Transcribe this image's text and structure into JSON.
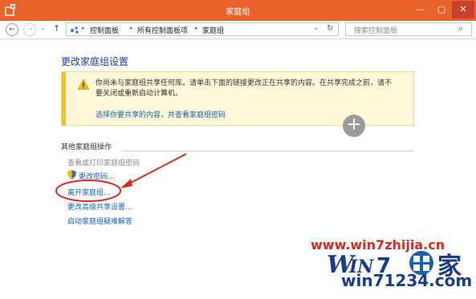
{
  "window": {
    "title": "家庭组",
    "minimize": "—",
    "maximize": "▢",
    "close": "✕"
  },
  "address": {
    "back": "←",
    "forward": "→",
    "up": "↑",
    "crumbs": [
      "控制面板",
      "所有控制面板项",
      "家庭组"
    ],
    "refresh": "↻",
    "dropdown": "⌄",
    "search_placeholder": "搜索控制面板",
    "search_icon": "⌕"
  },
  "main": {
    "heading": "更改家庭组设置",
    "warning": {
      "icon": "warning-icon",
      "text": "你尚未与家庭组共享任何库。请单击下面的链接更改正在共享的内容。在共享完成之前，请不要关闭或重新启动计算机。",
      "link": "选择你要共享的内容，并查看家庭组密码"
    },
    "plus": "+",
    "section_title": "其他家庭组操作",
    "actions": [
      {
        "label": "查看或打印家庭组密码",
        "enabled": false
      },
      {
        "label": "更改密码...",
        "enabled": true,
        "icon": "shield-icon"
      },
      {
        "label": "离开家庭组...",
        "enabled": true
      },
      {
        "label": "更改高级共享设置...",
        "enabled": true
      },
      {
        "label": "启动家庭组疑难解答",
        "enabled": true
      }
    ]
  },
  "watermark": {
    "url": "www.win7zhijia.cn",
    "logo": "WIN7家",
    "site": "win71234.com",
    "colors": {
      "red": "#d82a20",
      "blue": "#1a3d8a"
    }
  },
  "colors": {
    "titlebar": "#e8622a",
    "link": "#1a5fb4",
    "heading": "#1f3f9a",
    "annotation": "#d82a20"
  }
}
